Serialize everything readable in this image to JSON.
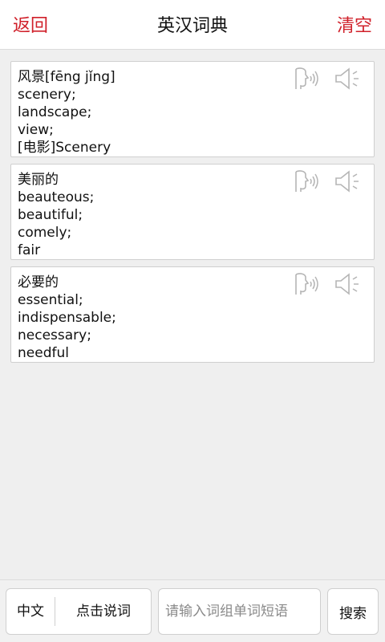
{
  "header": {
    "back_label": "返回",
    "title": "英汉词典",
    "clear_label": "清空"
  },
  "results": [
    {
      "lines": [
        "风景[fēng jǐng]",
        "scenery;",
        "landscape;",
        "view;",
        "[电影]Scenery"
      ],
      "speak_icon": "voice-input-icon",
      "speaker_icon": "speaker-icon"
    },
    {
      "lines": [
        "美丽的",
        "beauteous;",
        "beautiful;",
        "comely;",
        "fair"
      ],
      "speak_icon": "voice-input-icon",
      "speaker_icon": "speaker-icon"
    },
    {
      "lines": [
        "必要的",
        "essential;",
        "indispensable;",
        "necessary;",
        "needful"
      ],
      "speak_icon": "voice-input-icon",
      "speaker_icon": "speaker-icon"
    }
  ],
  "bottom": {
    "language_label": "中文",
    "voice_label": "点击说词",
    "search_placeholder": "请输入词组单词短语",
    "search_value": "",
    "search_button_label": "搜索"
  },
  "colors": {
    "accent": "#d0202a",
    "icon": "#b5b5b5"
  }
}
